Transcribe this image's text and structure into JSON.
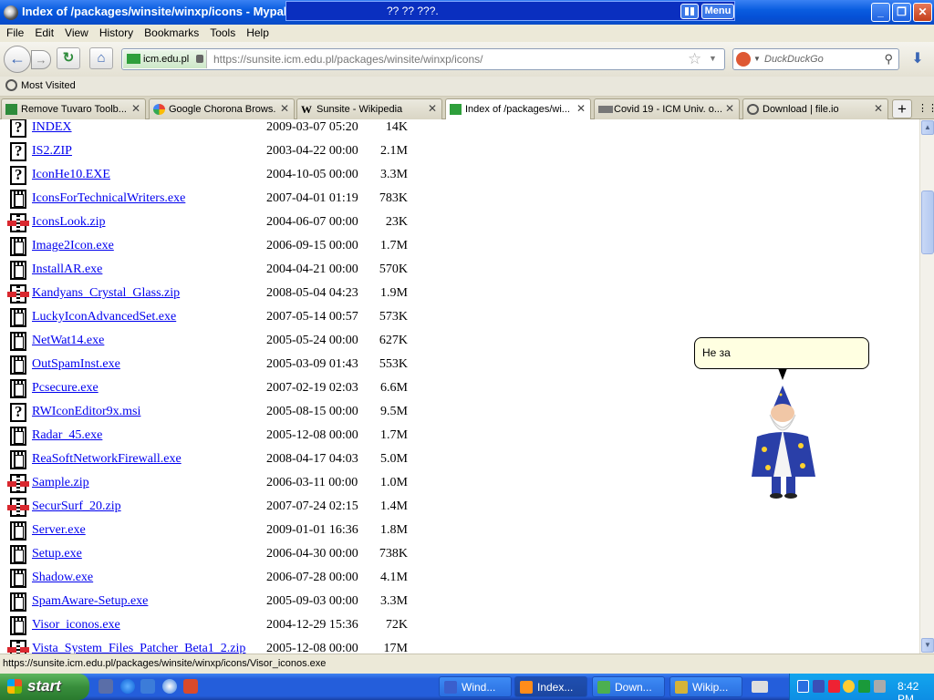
{
  "window": {
    "title": "Index of /packages/winsite/winxp/icons - Mypal",
    "overlay_text": "?? ?? ???.",
    "overlay_menu": "Menu",
    "min": "_",
    "max": "❐",
    "close": "✕"
  },
  "menu": [
    "File",
    "Edit",
    "View",
    "History",
    "Bookmarks",
    "Tools",
    "Help"
  ],
  "nav": {
    "back": "←",
    "forward": "→",
    "reload": "↻",
    "home": "⌂",
    "site_identity": "icm.edu.pl",
    "url": "https://sunsite.icm.edu.pl/packages/winsite/winxp/icons/",
    "star": "☆",
    "dropmarker": "▼",
    "search_caret": "▼",
    "search_placeholder": "DuckDuckGo",
    "search_icon": "⚲",
    "download": "⬇"
  },
  "bookmarks": {
    "most_visited": "Most Visited"
  },
  "tabs": [
    {
      "label": "Remove Tuvaro Toolb...",
      "active": false,
      "close": "✕"
    },
    {
      "label": "Google Chorona Brows...",
      "active": false,
      "close": "✕"
    },
    {
      "label": "Sunsite - Wikipedia",
      "active": false,
      "close": "✕"
    },
    {
      "label": "Index of /packages/wi...",
      "active": true,
      "close": "✕"
    },
    {
      "label": "Covid 19 - ICM Univ. o...",
      "active": false,
      "close": "✕"
    },
    {
      "label": "Download | file.io",
      "active": false,
      "close": "✕"
    }
  ],
  "tab_actions": {
    "new_tab": "+",
    "list_all": "⋮⋮"
  },
  "files": [
    {
      "name": "INDEX",
      "date": "2009-03-07 05:20",
      "size": "14K",
      "icon": "unknown"
    },
    {
      "name": "IS2.ZIP",
      "date": "2003-04-22 00:00",
      "size": "2.1M",
      "icon": "unknown"
    },
    {
      "name": "IconHe10.EXE",
      "date": "2004-10-05 00:00",
      "size": "3.3M",
      "icon": "unknown"
    },
    {
      "name": "IconsForTechnicalWriters.exe",
      "date": "2007-04-01 01:19",
      "size": "783K",
      "icon": "binary"
    },
    {
      "name": "IconsLook.zip",
      "date": "2004-06-07 00:00",
      "size": "23K",
      "icon": "compressed"
    },
    {
      "name": "Image2Icon.exe",
      "date": "2006-09-15 00:00",
      "size": "1.7M",
      "icon": "binary"
    },
    {
      "name": "InstallAR.exe",
      "date": "2004-04-21 00:00",
      "size": "570K",
      "icon": "binary"
    },
    {
      "name": "Kandyans_Crystal_Glass.zip",
      "date": "2008-05-04 04:23",
      "size": "1.9M",
      "icon": "compressed"
    },
    {
      "name": "LuckyIconAdvancedSet.exe",
      "date": "2007-05-14 00:57",
      "size": "573K",
      "icon": "binary"
    },
    {
      "name": "NetWat14.exe",
      "date": "2005-05-24 00:00",
      "size": "627K",
      "icon": "binary"
    },
    {
      "name": "OutSpamInst.exe",
      "date": "2005-03-09 01:43",
      "size": "553K",
      "icon": "binary"
    },
    {
      "name": "Pcsecure.exe",
      "date": "2007-02-19 02:03",
      "size": "6.6M",
      "icon": "binary"
    },
    {
      "name": "RWIconEditor9x.msi",
      "date": "2005-08-15 00:00",
      "size": "9.5M",
      "icon": "unknown"
    },
    {
      "name": "Radar_45.exe",
      "date": "2005-12-08 00:00",
      "size": "1.7M",
      "icon": "binary"
    },
    {
      "name": "ReaSoftNetworkFirewall.exe",
      "date": "2008-04-17 04:03",
      "size": "5.0M",
      "icon": "binary"
    },
    {
      "name": "Sample.zip",
      "date": "2006-03-11 00:00",
      "size": "1.0M",
      "icon": "compressed"
    },
    {
      "name": "SecurSurf_20.zip",
      "date": "2007-07-24 02:15",
      "size": "1.4M",
      "icon": "compressed"
    },
    {
      "name": "Server.exe",
      "date": "2009-01-01 16:36",
      "size": "1.8M",
      "icon": "binary"
    },
    {
      "name": "Setup.exe",
      "date": "2006-04-30 00:00",
      "size": "738K",
      "icon": "binary"
    },
    {
      "name": "Shadow.exe",
      "date": "2006-07-28 00:00",
      "size": "4.1M",
      "icon": "binary"
    },
    {
      "name": "SpamAware-Setup.exe",
      "date": "2005-09-03 00:00",
      "size": "3.3M",
      "icon": "binary"
    },
    {
      "name": "Visor_iconos.exe",
      "date": "2004-12-29 15:36",
      "size": "72K",
      "icon": "binary"
    },
    {
      "name": "Vista_System_Files_Patcher_Beta1_2.zip",
      "date": "2005-12-08 00:00",
      "size": "17M",
      "icon": "compressed"
    }
  ],
  "assistant": {
    "bubble_text": "Не за"
  },
  "scrollbar": {
    "up": "▲",
    "down": "▼"
  },
  "status": {
    "text": "https://sunsite.icm.edu.pl/packages/winsite/winxp/icons/Visor_iconos.exe"
  },
  "taskbar": {
    "start_label": "start",
    "tasks": [
      {
        "label": "Wind...",
        "active": false,
        "icon_color": "#3a5fcd"
      },
      {
        "label": "Index...",
        "active": true,
        "icon_color": "#ff8c1a"
      },
      {
        "label": "Down...",
        "active": false,
        "icon_color": "#4caf50"
      },
      {
        "label": "Wikip...",
        "active": false,
        "icon_color": "#d4b338"
      }
    ],
    "clock": "8:42 PM"
  }
}
